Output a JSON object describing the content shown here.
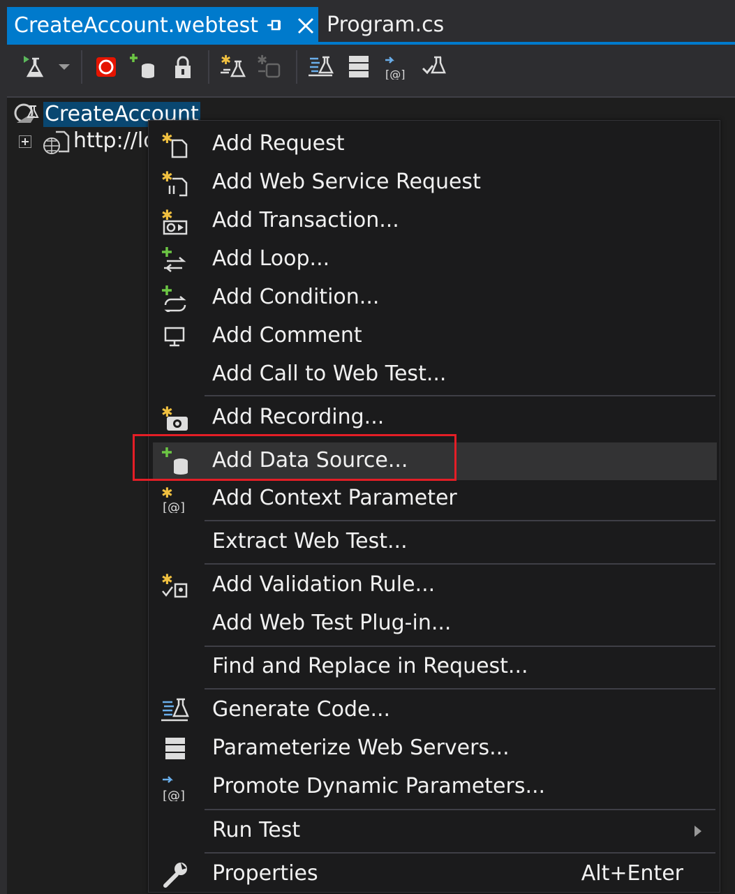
{
  "tabs": {
    "active_label": "CreateAccount.webtest",
    "second_label": "Program.cs"
  },
  "tree": {
    "root_label": "CreateAccount",
    "child_label": "http://lo"
  },
  "menu": {
    "items": [
      {
        "label": "Add Request",
        "icon": "add-request-icon"
      },
      {
        "label": "Add Web Service Request",
        "icon": "add-web-service-request-icon"
      },
      {
        "label": "Add Transaction...",
        "icon": "add-transaction-icon"
      },
      {
        "label": "Add Loop...",
        "icon": "add-loop-icon"
      },
      {
        "label": "Add Condition...",
        "icon": "add-condition-icon"
      },
      {
        "label": "Add Comment",
        "icon": "comment-icon"
      },
      {
        "label": "Add Call to Web Test...",
        "icon": ""
      },
      {
        "label": "Add Recording...",
        "icon": "add-recording-icon"
      },
      {
        "label": "Add Data Source...",
        "icon": "add-data-source-icon"
      },
      {
        "label": "Add Context Parameter",
        "icon": "add-context-parameter-icon"
      },
      {
        "label": "Extract Web Test...",
        "icon": ""
      },
      {
        "label": "Add Validation Rule...",
        "icon": "add-validation-rule-icon"
      },
      {
        "label": "Add Web Test Plug-in...",
        "icon": ""
      },
      {
        "label": "Find and Replace in Request...",
        "icon": ""
      },
      {
        "label": "Generate Code...",
        "icon": "generate-code-icon"
      },
      {
        "label": "Parameterize Web Servers...",
        "icon": "parameterize-servers-icon"
      },
      {
        "label": "Promote Dynamic Parameters...",
        "icon": "promote-parameters-icon"
      },
      {
        "label": "Run Test",
        "icon": ""
      },
      {
        "label": "Properties",
        "icon": "wrench-icon",
        "shortcut": "Alt+Enter"
      }
    ]
  },
  "colors": {
    "accent": "#007acc",
    "highlight_box": "#e41e26",
    "menu_bg": "#1b1b1c",
    "selection": "#094771"
  }
}
